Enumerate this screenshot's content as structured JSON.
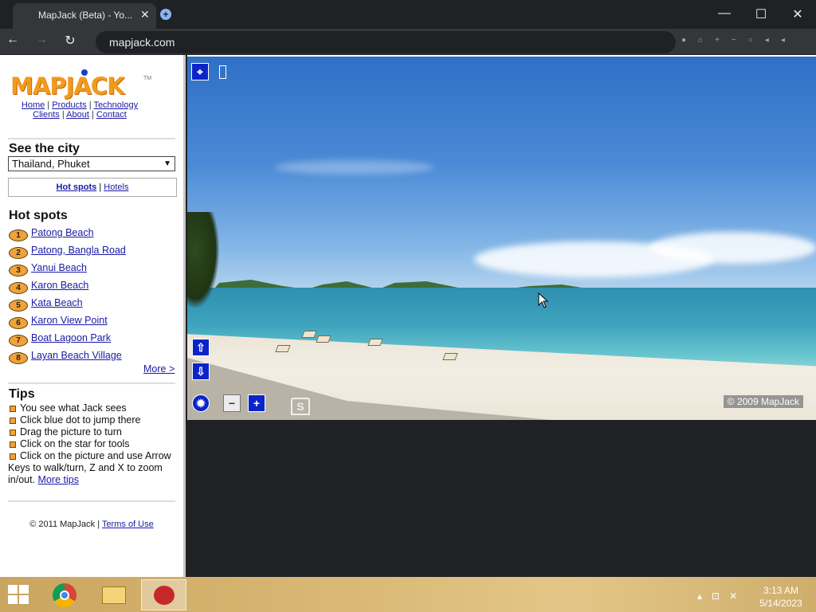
{
  "browser": {
    "tab_title": "MapJack (Beta) - Yo...",
    "tab_close": "✕",
    "url": "mapjack.com",
    "window_controls": {
      "minimize": "—",
      "maximize": "☐",
      "close": "✕"
    },
    "nav": {
      "back": "←",
      "forward": "→",
      "reload": "↻"
    }
  },
  "sidebar": {
    "logo_text": "MAPJACK",
    "logo_tm": "TM",
    "nav_row1": [
      "Home",
      "Products",
      "Technology"
    ],
    "nav_row2": [
      "Clients",
      "About",
      "Contact"
    ],
    "nav_sep": " | ",
    "see_city_heading": "See the city",
    "city_selected": "Thailand, Phuket",
    "filter": {
      "hot_spots": "Hot spots",
      "hotels": "Hotels",
      "sep": " | "
    },
    "hot_spots_heading": "Hot spots",
    "spots": [
      {
        "num": "1",
        "label": "Patong Beach"
      },
      {
        "num": "2",
        "label": "Patong, Bangla Road"
      },
      {
        "num": "3",
        "label": "Yanui Beach"
      },
      {
        "num": "4",
        "label": "Karon Beach"
      },
      {
        "num": "5",
        "label": "Kata Beach"
      },
      {
        "num": "6",
        "label": "Karon View Point"
      },
      {
        "num": "7",
        "label": "Boat Lagoon Park"
      },
      {
        "num": "8",
        "label": "Layan Beach Village"
      }
    ],
    "more_link": "More >",
    "tips_heading": "Tips",
    "tips": [
      "You see what Jack sees",
      "Click blue dot to jump there",
      "Drag the picture to turn",
      "Click on the star for tools",
      "Click on the picture and use Arrow Keys to walk/turn, Z and X to zoom in/out."
    ],
    "more_tips": "More tips",
    "footer_text": "© 2011 MapJack | ",
    "terms": "Terms of Use"
  },
  "viewer": {
    "copyright": "© 2009 MapJack",
    "controls": {
      "forward": "⇧",
      "backward": "⇩",
      "star": "✹",
      "zoom_out": "−",
      "zoom_in": "+",
      "s_badge": "S"
    }
  },
  "taskbar": {
    "time": "3:13 AM",
    "date": "5/14/2023"
  },
  "colors": {
    "brand_orange": "#f39a1e",
    "link_blue": "#1a1aa6",
    "control_blue": "#0a24c8"
  }
}
